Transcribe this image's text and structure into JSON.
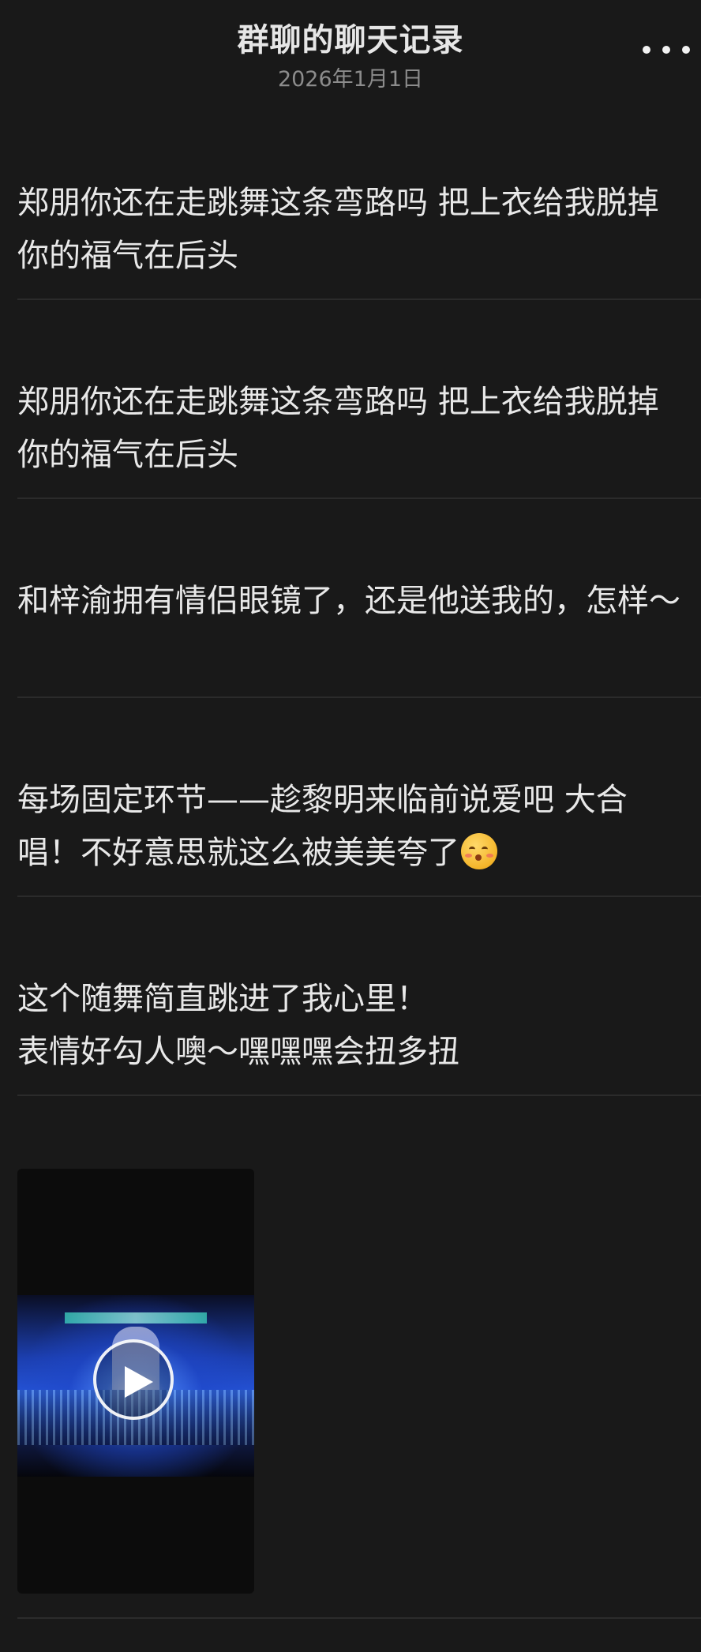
{
  "header": {
    "title": "群聊的聊天记录",
    "date": "2026年1月1日"
  },
  "icons": {
    "more": "more-dots-icon",
    "play": "play-icon",
    "emoji": "kissing-face-emoji"
  },
  "messages": [
    {
      "text": "郑朋你还在走跳舞这条弯路吗 把上衣给我脱掉 你的福气在后头"
    },
    {
      "text": "郑朋你还在走跳舞这条弯路吗 把上衣给我脱掉 你的福气在后头"
    },
    {
      "text": "和梓渝拥有情侣眼镜了，还是他送我的，怎样～"
    },
    {
      "text": "每场固定环节——趁黎明来临前说爱吧 大合唱！不好意思就这么被美美夸了"
    },
    {
      "text": "这个随舞简直跳进了我心里！\n表情好勾人噢～嘿嘿嘿会扭多扭"
    }
  ],
  "video": {
    "label": "video-message"
  },
  "colors": {
    "background": "#191919",
    "text": "#e8e8e8",
    "date": "#8c8c8c",
    "divider": "#2b2b2b"
  }
}
